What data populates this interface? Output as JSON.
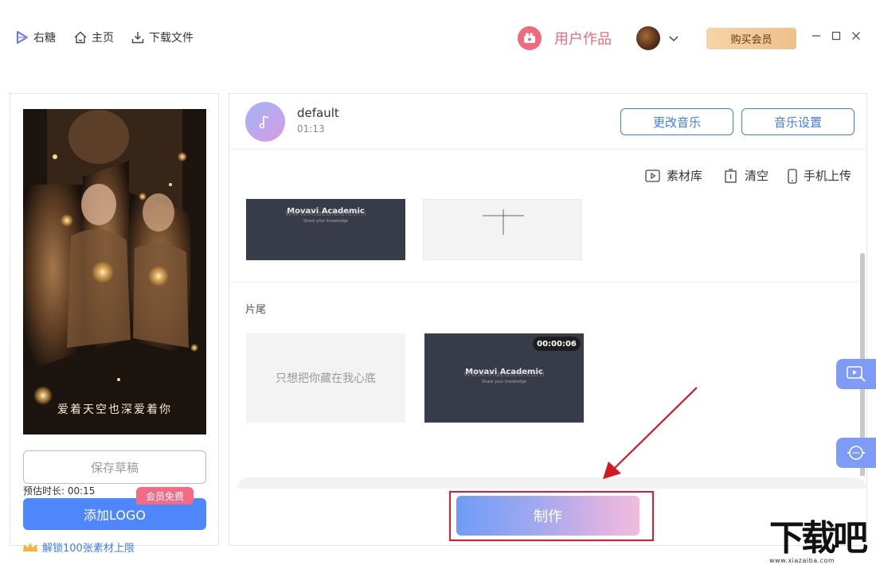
{
  "nav": {
    "app_name": "右糖",
    "home": "主页",
    "download": "下载文件"
  },
  "header": {
    "user_works": "用户作品",
    "buy_vip": "购买会员"
  },
  "preview": {
    "caption": "爱着天空也深爱着你"
  },
  "left": {
    "save_draft": "保存草稿",
    "estimated_duration": "预估时长: 00:15",
    "add_logo": "添加LOGO",
    "vip_free": "会员免费",
    "unlock": "解锁100张素材上限"
  },
  "music": {
    "name": "default",
    "time": "01:13",
    "change_music": "更改音乐",
    "music_settings": "音乐设置"
  },
  "tools": {
    "library": "素材库",
    "clear": "清空",
    "phone_upload": "手机上传"
  },
  "clips": {
    "thumb_title": "Movavi Academic",
    "thumb_subtitle": "Share your knowledge",
    "watermark": "www.xiazaiba.com"
  },
  "ending": {
    "section_label": "片尾",
    "text_tile": "只想把你藏在我心底",
    "duration_badge": "00:00:06"
  },
  "make": {
    "label": "制作"
  },
  "site_logo": {
    "brand": "下载吧",
    "url": "www.xiazaiba.com"
  },
  "colors": {
    "accent_blue": "#3f7bf6",
    "accent_pink": "#f06a7b",
    "highlight_red": "#e2192f"
  }
}
